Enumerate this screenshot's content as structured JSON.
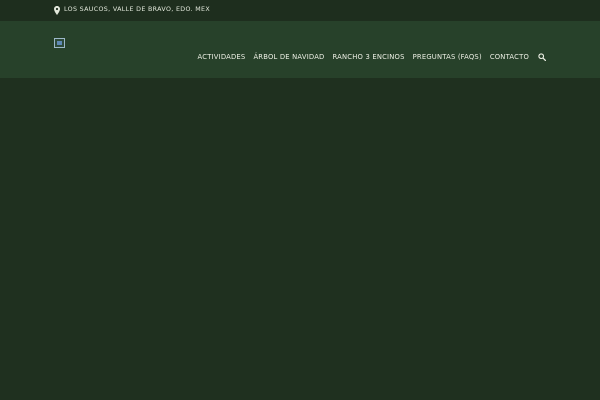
{
  "topbar": {
    "location_icon": "map-pin-icon",
    "location_text": "LOS SAUCOS, VALLE DE BRAVO, EDO. MEX"
  },
  "header": {
    "logo_icon": "broken-image-logo"
  },
  "nav": {
    "items": [
      {
        "label": "ACTIVIDADES"
      },
      {
        "label": "ÁRBOL DE NAVIDAD"
      },
      {
        "label": "RANCHO 3 ENCINOS"
      },
      {
        "label": "PREGUNTAS (FAQS)"
      },
      {
        "label": "CONTACTO"
      }
    ],
    "search_icon": "search-icon"
  },
  "colors": {
    "topbar_bg": "#1e2e1e",
    "header_bg": "#27412a",
    "page_bg": "#1f301f",
    "text": "#ecefe4"
  }
}
